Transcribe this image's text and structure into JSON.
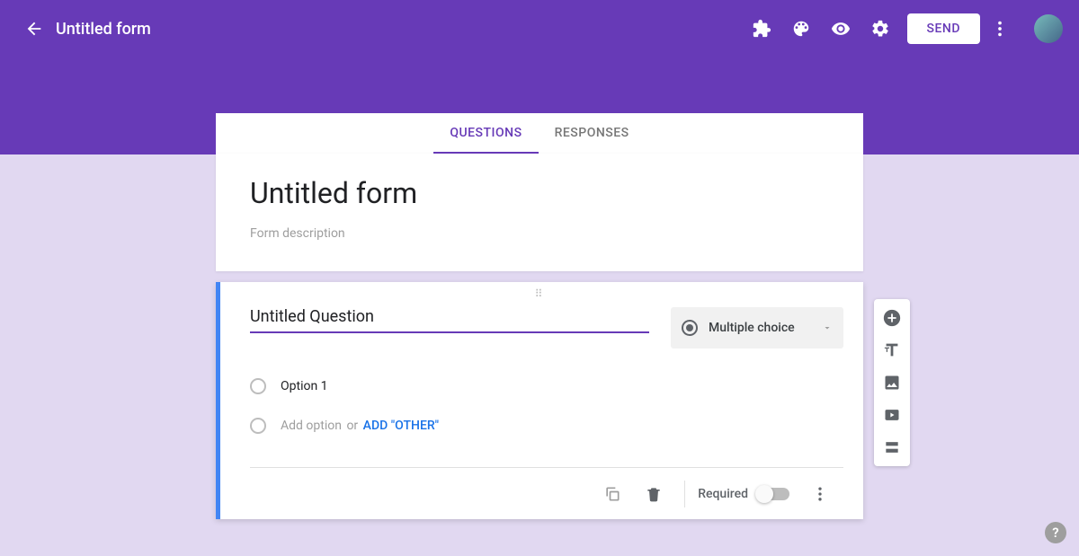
{
  "header": {
    "title": "Untitled form",
    "send_label": "SEND"
  },
  "tabs": {
    "questions": "QUESTIONS",
    "responses": "RESPONSES"
  },
  "form": {
    "title": "Untitled form",
    "description_placeholder": "Form description"
  },
  "question": {
    "title": "Untitled Question",
    "type_label": "Multiple choice",
    "option1": "Option 1",
    "add_option": "Add option",
    "or": "or",
    "add_other": "ADD \"OTHER\"",
    "required_label": "Required"
  }
}
